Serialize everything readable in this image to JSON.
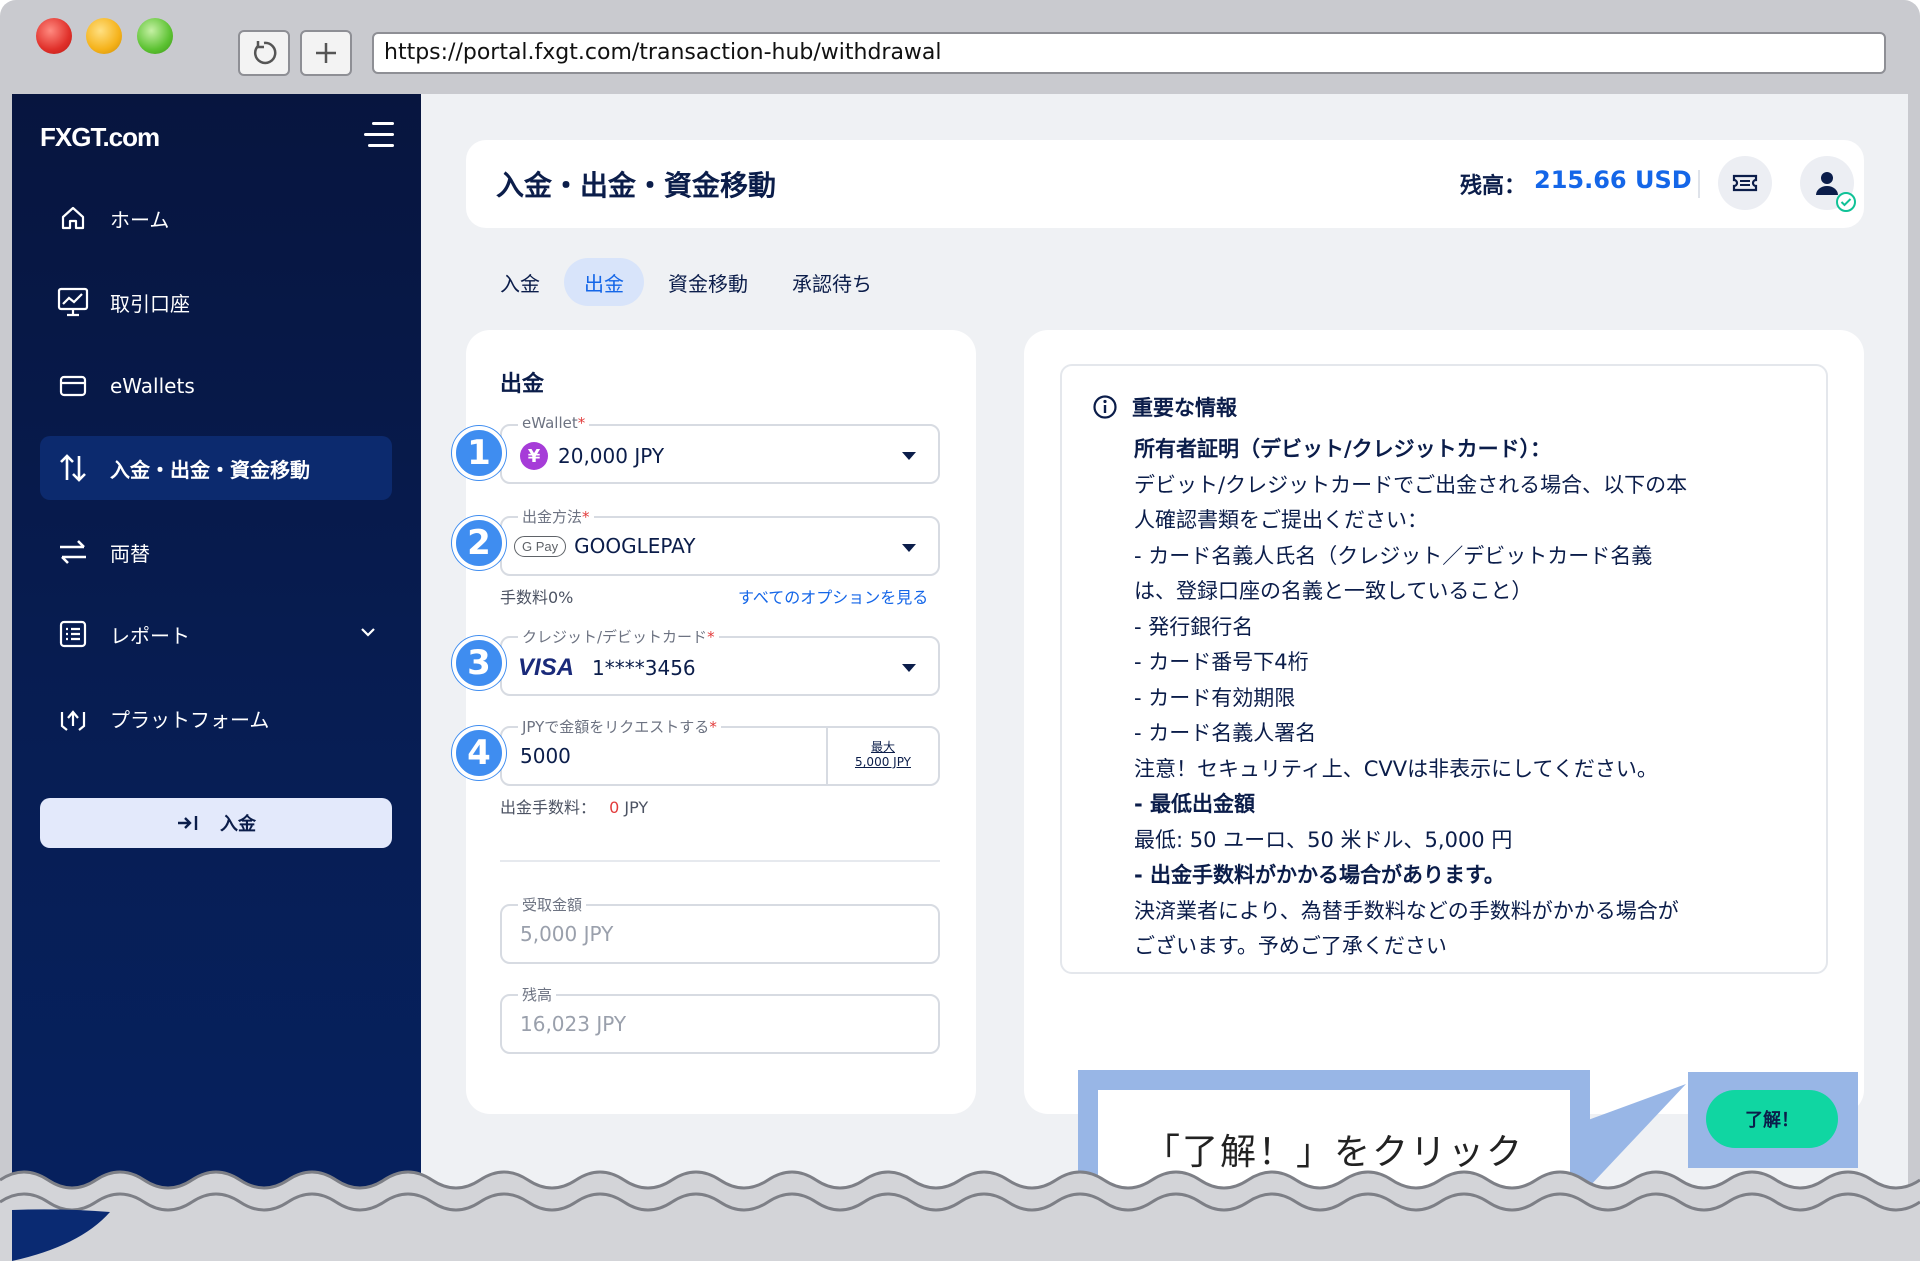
{
  "browser": {
    "url": "https://portal.fxgt.com/transaction-hub/withdrawal"
  },
  "sidebar": {
    "logo": "FXGT.com",
    "items": [
      {
        "label": "ホーム",
        "icon": "home-icon"
      },
      {
        "label": "取引口座",
        "icon": "chart-monitor-icon"
      },
      {
        "label": "eWallets",
        "icon": "wallet-icon"
      },
      {
        "label": "入金・出金・資金移動",
        "icon": "transfer-arrows-icon"
      },
      {
        "label": "両替",
        "icon": "exchange-icon"
      },
      {
        "label": "レポート",
        "icon": "report-icon"
      },
      {
        "label": "プラットフォーム",
        "icon": "platform-icon"
      }
    ],
    "deposit_button": "入金"
  },
  "header": {
    "title": "入金・出金・資金移動",
    "balance_label": "残高：",
    "balance_value": "215.66 USD"
  },
  "tabs": [
    "入金",
    "出金",
    "資金移動",
    "承認待ち"
  ],
  "withdraw": {
    "title": "出金",
    "ewallet": {
      "label": "eWallet",
      "value": "20,000 JPY",
      "currency_symbol": "¥"
    },
    "method": {
      "label": "出金方法",
      "value": "GOOGLEPAY",
      "badge": "G Pay"
    },
    "fee_text": "手数料0%",
    "options_link": "すべてのオプションを見る",
    "card": {
      "label": "クレジット/デビットカード",
      "brand": "VISA",
      "value": "1****3456"
    },
    "amount": {
      "label": "JPYで金額をリクエストする",
      "value": "5000",
      "max_label": "最大",
      "max_value": "5,000 JPY"
    },
    "withdraw_fee_label": "出金手数料：",
    "withdraw_fee_value": "0",
    "withdraw_fee_unit": "JPY",
    "receive": {
      "label": "受取金額",
      "value": "5,000 JPY"
    },
    "remaining": {
      "label": "残高",
      "value": "16,023 JPY"
    },
    "steps": [
      "1",
      "2",
      "3",
      "4"
    ]
  },
  "info": {
    "heading": "重要な情報",
    "lines": [
      "所有者証明（デビット/クレジットカード）：",
      "デビット/クレジットカードでご出金される場合、以下の本",
      "人確認書類をご提出ください：",
      "- カード名義人氏名（クレジット／デビットカード名義",
      "は、登録口座の名義と一致していること）",
      "- 発行銀行名",
      "- カード番号下4桁",
      "- カード有効期限",
      "- カード名義人署名",
      "注意！セキュリティ上、CVVは非表示にしてください。",
      "- 最低出金額",
      "最低: 50 ユーロ、50 米ドル、5,000 円",
      "- 出金手数料がかかる場合があります。",
      "決済業者により、為替手数料などの手数料がかかる場合が",
      "ございます。予めご了承ください"
    ],
    "ok_button": "了解！"
  },
  "callout": {
    "text": "「了解！」をクリック"
  },
  "colors": {
    "sidebar": "#07153f",
    "accent": "#1466e8",
    "ok": "#10d6a2",
    "step": "#3f8df0",
    "callout": "#98b6e6"
  }
}
